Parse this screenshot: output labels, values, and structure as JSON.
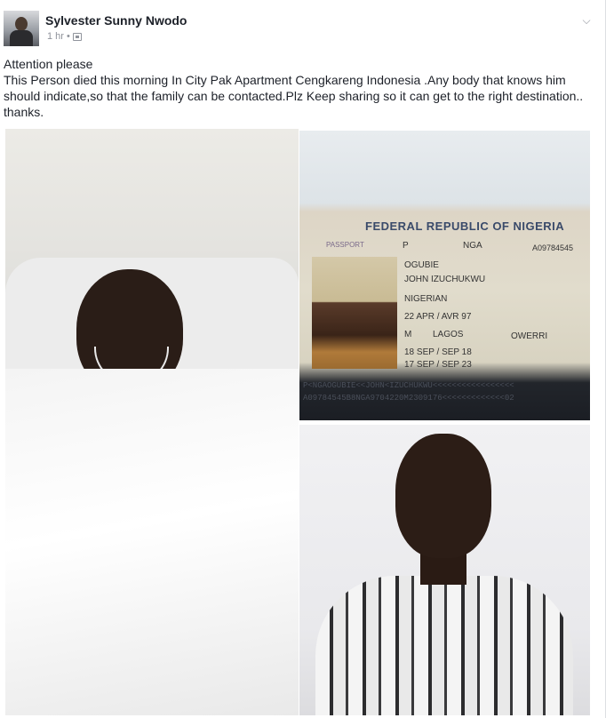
{
  "post": {
    "author": "Sylvester Sunny Nwodo",
    "time": "1 hr",
    "separator": "•",
    "privacy_icon": "globe-icon",
    "menu_icon": "chevron-down-icon",
    "message": {
      "line1": "Attention please",
      "line2": "This Person died this morning In  City Pak Apartment  Cengkareng Indonesia .Any body that knows him should indicate,so that the family can be contacted.Plz Keep sharing so it can get to the right destination.. thanks."
    }
  },
  "photos": {
    "passport": {
      "title": "FEDERAL REPUBLIC OF NIGERIA",
      "label_passport": "PASSPORT",
      "type": "P",
      "country": "NGA",
      "number": "A09784545",
      "surname": "OGUBIE",
      "given_names": "JOHN IZUCHUKWU",
      "nationality": "NIGERIAN",
      "dob": "22 APR / AVR 97",
      "sex": "M",
      "place_of_birth": "LAGOS",
      "authority": "OWERRI",
      "issue_date": "18 SEP / SEP 18",
      "expiry_date": "17 SEP / SEP 23",
      "mrz1": "P<NGAOGUBIE<<JOHN<IZUCHUKWU<<<<<<<<<<<<<<<<<",
      "mrz2": "A09784545B8NGA9704220M2309176<<<<<<<<<<<<<02"
    }
  }
}
